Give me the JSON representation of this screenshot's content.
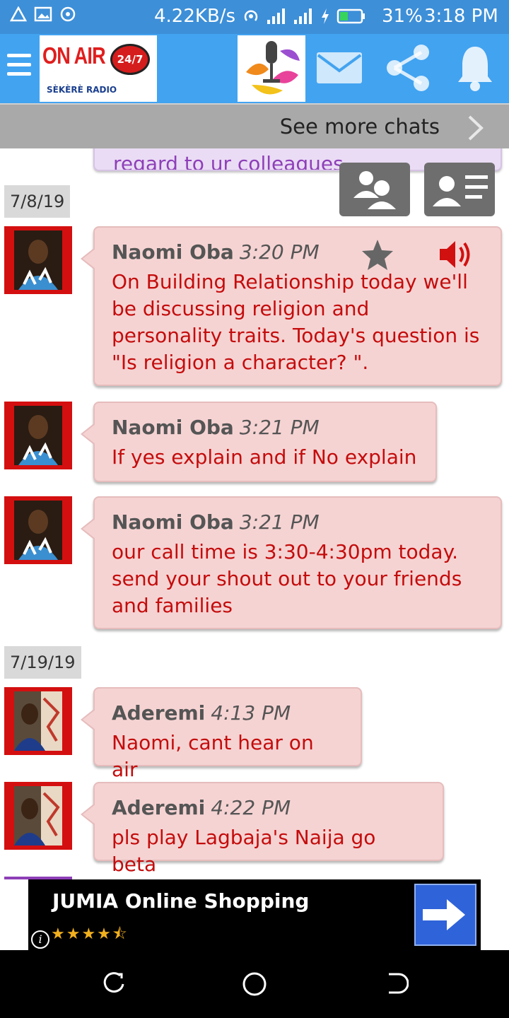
{
  "status_bar": {
    "network_speed": "4.22KB/s",
    "battery_percent": "31%",
    "time": "3:18 PM"
  },
  "app_bar": {
    "logo_text": "ON AIR",
    "logo_badge": "24/7",
    "logo_subtitle": "SÈKÈRÈ RADIO",
    "icons": [
      "menu-icon",
      "mail-icon",
      "share-icon",
      "bell-icon"
    ],
    "accent_color": "#42a3f0"
  },
  "see_more": {
    "label": "See more chats"
  },
  "previous_message": {
    "text": "regard to ur colleagues."
  },
  "dates": {
    "first": "7/8/19",
    "second": "7/19/19"
  },
  "messages": [
    {
      "author": "Naomi Oba",
      "time": "3:20 PM",
      "text": "On Building Relationship today we'll be discussing religion and personality traits. Today's question is \"Is religion a character? \"."
    },
    {
      "author": "Naomi Oba",
      "time": "3:21 PM",
      "text": "If yes explain and if No explain"
    },
    {
      "author": "Naomi Oba",
      "time": "3:21 PM",
      "text": "our call time is 3:30-4:30pm today. send your shout out to your friends and families"
    },
    {
      "author": "Aderemi",
      "time": "4:13 PM",
      "text": "Naomi, cant hear on air"
    },
    {
      "author": "Aderemi",
      "time": "4:22 PM",
      "text": "pls play Lagbaja's Naija go beta"
    }
  ],
  "ad": {
    "title": "JUMIA Online Shopping",
    "rating": 4.5,
    "stars_display": "★★★★⯪",
    "info_label": "i"
  },
  "colors": {
    "message_text": "#c40c0c",
    "bubble_bg": "#f6d3d3",
    "avatar_border": "#d40f0f"
  }
}
